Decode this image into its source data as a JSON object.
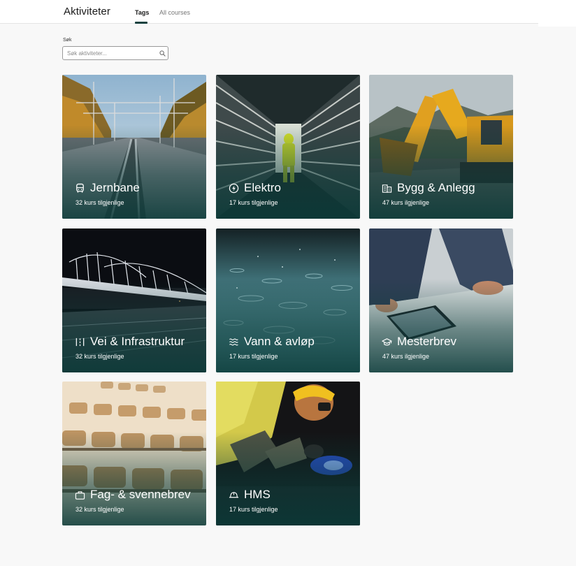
{
  "header": {
    "brand": "Aktiviteter",
    "tabs": [
      {
        "label": "Tags",
        "active": true
      },
      {
        "label": "All courses",
        "active": false
      }
    ]
  },
  "search": {
    "label": "Søk",
    "placeholder": "Søk aktiviteter...",
    "value": ""
  },
  "colors": {
    "accent": "#16413f",
    "card_overlay": "#0c3c3a"
  },
  "cards": [
    {
      "title": "Jernbane",
      "count": "32 kurs tilgjenlige",
      "icon": "train-icon"
    },
    {
      "title": "Elektro",
      "count": "17 kurs tilgjenlige",
      "icon": "lightning-icon"
    },
    {
      "title": "Bygg & Anlegg",
      "count": "47 kurs ilgjenlige",
      "icon": "building-icon"
    },
    {
      "title": "Vei & Infrastruktur",
      "count": "32 kurs tilgjenlige",
      "icon": "road-icon"
    },
    {
      "title": "Vann & avløp",
      "count": "17 kurs tilgjenlige",
      "icon": "water-waves-icon"
    },
    {
      "title": "Mesterbrev",
      "count": "47 kurs ilgjenlige",
      "icon": "graduation-cap-icon"
    },
    {
      "title": "Fag- & svennebrev",
      "count": "32 kurs tilgjenlige",
      "icon": "briefcase-icon"
    },
    {
      "title": "HMS",
      "count": "17 kurs tilgjenlige",
      "icon": "hard-hat-icon"
    }
  ]
}
